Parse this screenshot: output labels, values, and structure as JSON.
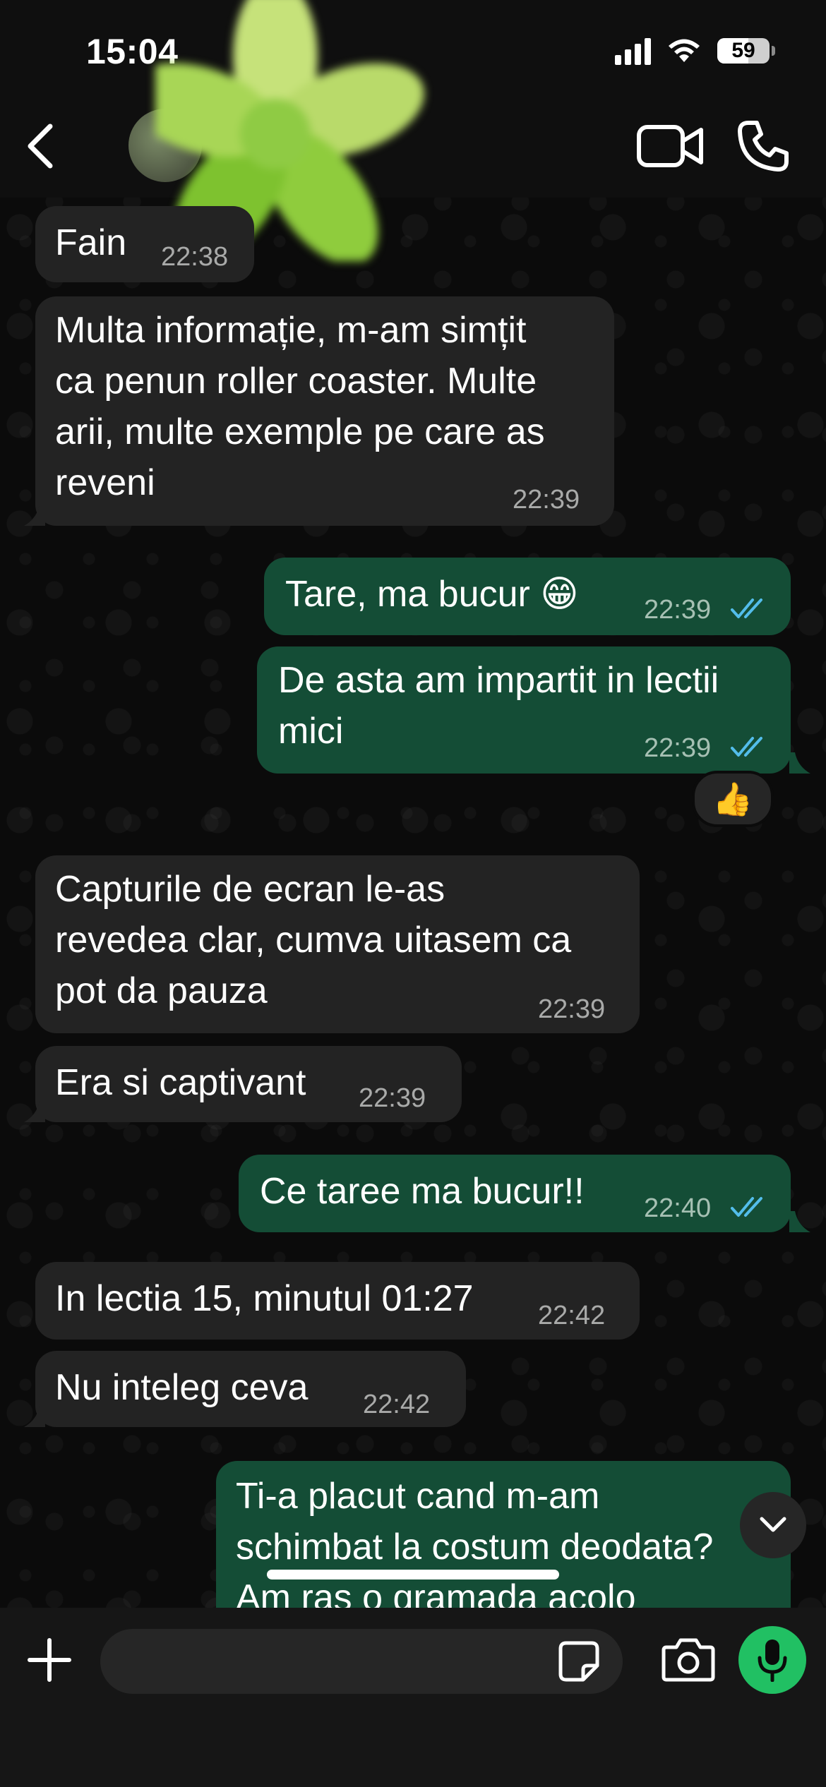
{
  "status_bar": {
    "time": "15:04",
    "battery_level": "59",
    "battery_fraction": 0.59
  },
  "header": {
    "contact_name": "",
    "back_icon": "chevron-left-icon",
    "video_icon": "video-camera-icon",
    "call_icon": "phone-icon"
  },
  "messages": [
    {
      "direction": "in",
      "text": "Fain",
      "time": "22:38"
    },
    {
      "direction": "in",
      "text_lines": [
        "Multa informație, m-am simțit",
        "ca penun roller coaster. Multe",
        "arii, multe exemple pe care as",
        "reveni"
      ],
      "time": "22:39"
    },
    {
      "direction": "out",
      "text": "Tare, ma bucur 😁",
      "time": "22:39",
      "status": "read"
    },
    {
      "direction": "out",
      "text_lines": [
        "De asta am impartit in lectii",
        "mici"
      ],
      "time": "22:39",
      "status": "read",
      "reaction": "👍"
    },
    {
      "direction": "in",
      "text_lines": [
        "Capturile de ecran le-as",
        "revedea clar, cumva uitasem ca",
        "pot da pauza"
      ],
      "time": "22:39"
    },
    {
      "direction": "in",
      "text": "Era si captivant",
      "time": "22:39"
    },
    {
      "direction": "out",
      "text": "Ce taree ma bucur!!",
      "time": "22:40",
      "status": "read"
    },
    {
      "direction": "in",
      "text": "In lectia 15, minutul 01:27",
      "time": "22:42"
    },
    {
      "direction": "in",
      "text": "Nu inteleg ceva",
      "time": "22:42"
    },
    {
      "direction": "out",
      "text_lines": [
        "Ti-a placut cand m-am",
        "schimbat la costum deodata?",
        "Am ras o gramada acolo"
      ]
    }
  ],
  "input_bar": {
    "placeholder": "",
    "attach_icon": "plus-icon",
    "sticker_icon": "sticker-icon",
    "camera_icon": "camera-icon",
    "mic_icon": "microphone-icon"
  },
  "colors": {
    "incoming_bubble": "#232323",
    "outgoing_bubble": "#144d36",
    "read_ticks": "#53bdeb",
    "mic_button": "#21c063"
  }
}
